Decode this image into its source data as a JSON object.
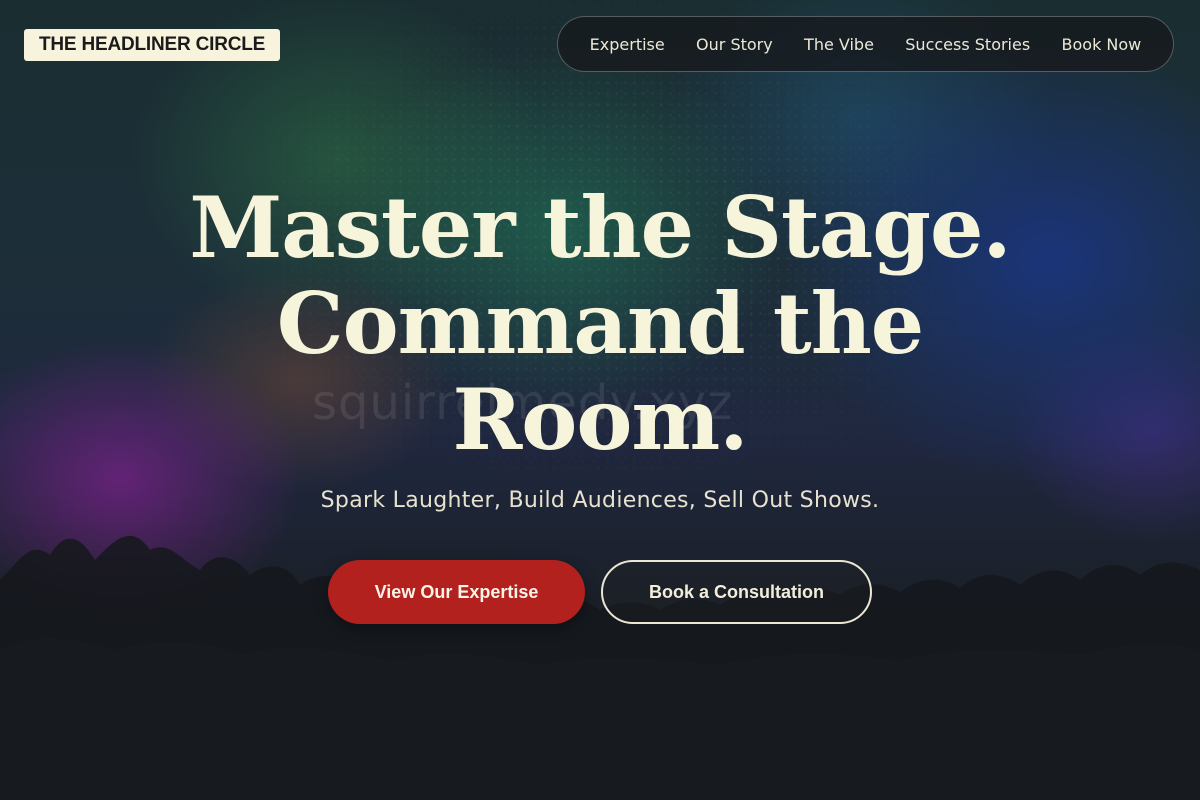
{
  "header": {
    "logo_text": "THE HEADLINER CIRCLE",
    "nav": [
      {
        "label": "Expertise"
      },
      {
        "label": "Our Story"
      },
      {
        "label": "The Vibe"
      },
      {
        "label": "Success Stories"
      },
      {
        "label": "Book Now"
      }
    ]
  },
  "hero": {
    "title_lines": [
      "Master the Stage.",
      "Command the",
      "Room."
    ],
    "watermark": "squirrelmedy.xyz",
    "subtitle": "Spark Laughter, Build Audiences, Sell Out Shows.",
    "primary_button": "View Our Expertise",
    "secondary_button": "Book a Consultation"
  },
  "colors": {
    "cream": "#f7f4dc",
    "primary_red": "#b3211f",
    "nav_bg": "#16181c"
  }
}
